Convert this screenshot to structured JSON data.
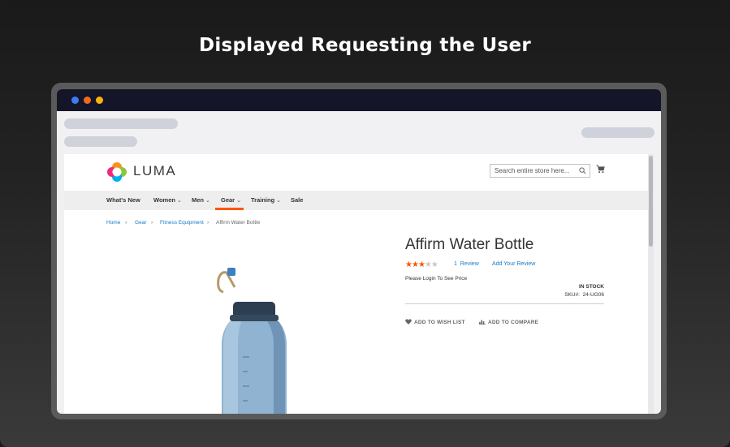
{
  "headline": "Displayed Requesting the User",
  "window": {
    "dots": [
      "#3b7cf5",
      "#f26b1d",
      "#f5b50c"
    ]
  },
  "store": {
    "logo_text": "LUMA",
    "search_placeholder": "Search entire store here...",
    "nav": [
      {
        "label": "What's New",
        "dropdown": false
      },
      {
        "label": "Women",
        "dropdown": true
      },
      {
        "label": "Men",
        "dropdown": true
      },
      {
        "label": "Gear",
        "dropdown": true,
        "active": true
      },
      {
        "label": "Training",
        "dropdown": true
      },
      {
        "label": "Sale",
        "dropdown": false
      }
    ],
    "breadcrumb": [
      "Home",
      "Gear",
      "Fitness Equipment",
      "Affirm Water Bottle"
    ],
    "product": {
      "title": "Affirm Water Bottle",
      "rating_stars": 3,
      "rating_max": 5,
      "review_count": "1",
      "review_label": "Review",
      "add_review": "Add Your Review",
      "price_notice": "Please Login To See Price",
      "stock": "IN STOCK",
      "sku_label": "SKU#:",
      "sku": "24-UG06",
      "wishlist": "ADD TO WISH LIST",
      "compare": "ADD TO COMPARE"
    },
    "accent_color": "#ff5501",
    "link_color": "#1979c3"
  }
}
